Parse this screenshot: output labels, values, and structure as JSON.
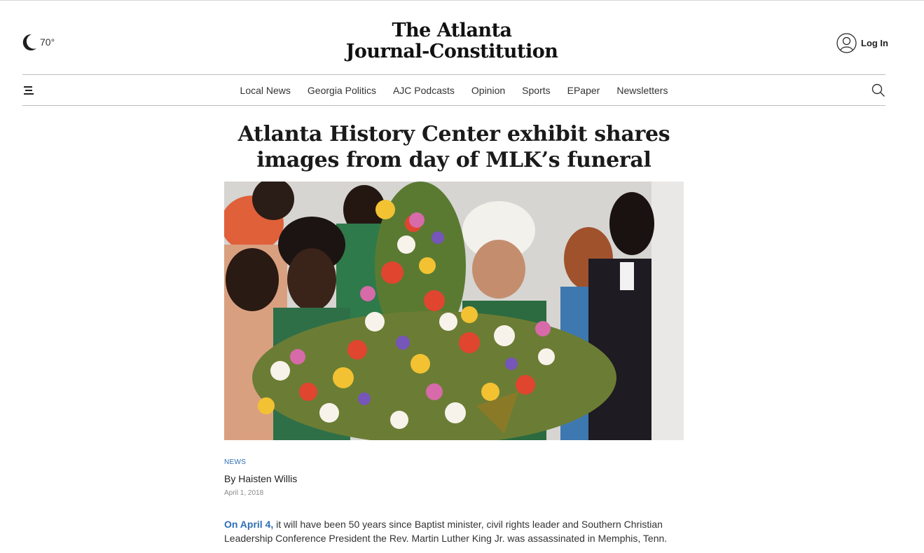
{
  "weather": {
    "temperature": "70°",
    "icon": "moon-icon"
  },
  "masthead": {
    "line1": "The Atlanta",
    "line2": "Journal-Constitution"
  },
  "account": {
    "login_label": "Log In",
    "icon": "user-circle-icon"
  },
  "nav": {
    "menu_icon": "hamburger-menu-icon",
    "search_icon": "search-icon",
    "items": [
      "Local News",
      "Georgia Politics",
      "AJC Podcasts",
      "Opinion",
      "Sports",
      "EPaper",
      "Newsletters"
    ]
  },
  "article": {
    "headline": "Atlanta History Center exhibit shares images from day of MLK’s funeral",
    "section": "NEWS",
    "byline": "By Haisten Willis",
    "date": "April 1, 2018",
    "lede_link": "On April 4,",
    "lede_text": " it will have been 50 years since Baptist minister, civil rights leader and Southern Christian Leadership Conference President the Rev. Martin Luther King Jr. was assassinated in Memphis, Tenn."
  },
  "colors": {
    "accent": "#2d6fb6",
    "text": "#222222",
    "rule": "#bdbdbd"
  }
}
